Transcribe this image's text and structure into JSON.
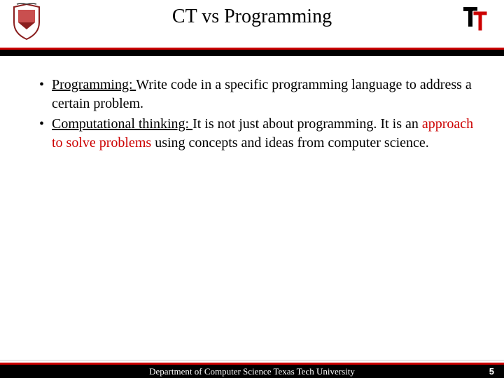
{
  "header": {
    "title": "CT vs Programming"
  },
  "bullets": [
    {
      "term": "Programming: ",
      "rest": "Write code in a specific programming language to address a certain problem."
    },
    {
      "term": "Computational thinking: ",
      "lead": "It is not just about programming. It is an ",
      "highlight": "approach to solve problems",
      "tail": " using concepts and ideas from computer science."
    }
  ],
  "footer": {
    "text": "Department of Computer Science Texas Tech University",
    "page": "5"
  }
}
